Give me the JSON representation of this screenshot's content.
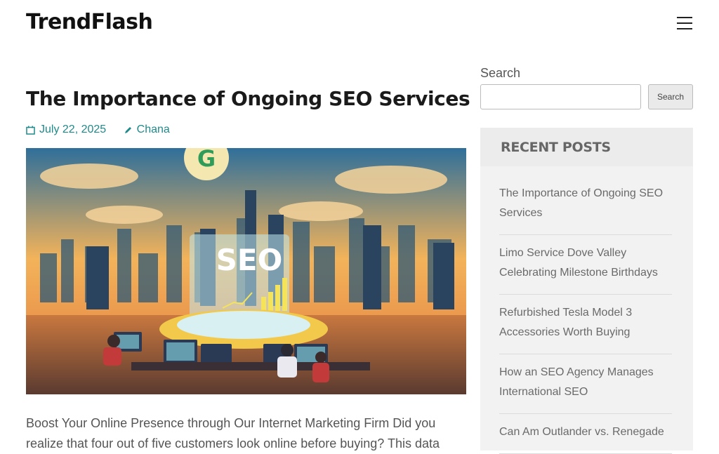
{
  "site": {
    "title": "TrendFlash"
  },
  "post": {
    "title": "The Importance of Ongoing SEO Services",
    "date": "July 22, 2025",
    "author": "Chana",
    "image_text": "SEO",
    "image_logo": "G",
    "excerpt": "Boost Your Online Presence through Our Internet Marketing Firm Did you realize that four out of five customers look online before buying? This data"
  },
  "sidebar": {
    "search_label": "Search",
    "search_value": "",
    "search_button": "Search",
    "recent_heading": "RECENT POSTS",
    "recent_posts": [
      "The Importance of Ongoing SEO Services",
      "Limo Service Dove Valley Celebrating Milestone Birthdays",
      "Refurbished Tesla Model 3 Accessories Worth Buying",
      "How an SEO Agency Manages International SEO",
      "Can Am Outlander vs. Renegade"
    ]
  },
  "colors": {
    "accent": "#1f8a8a"
  }
}
